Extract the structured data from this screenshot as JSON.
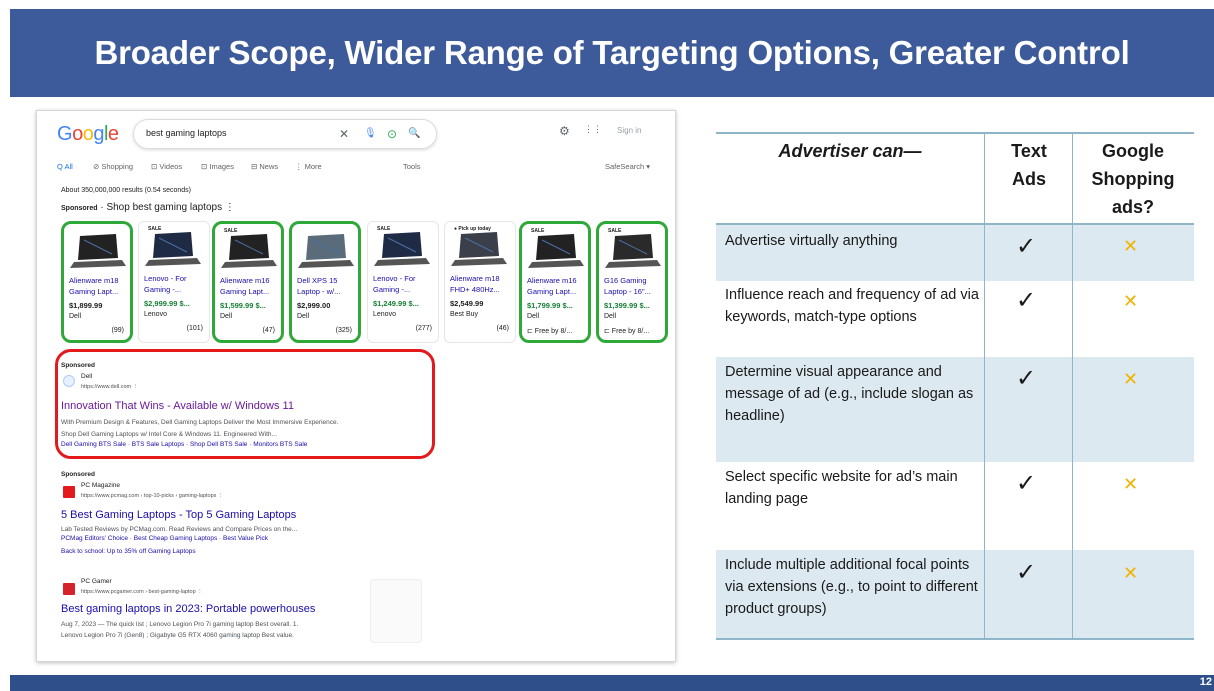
{
  "slide": {
    "title": "Broader Scope, Wider Range of Targeting Options, Greater Control",
    "page_number": "12"
  },
  "google": {
    "logo_letters": [
      {
        "ch": "G",
        "color": "#4285f4"
      },
      {
        "ch": "o",
        "color": "#ea4335"
      },
      {
        "ch": "o",
        "color": "#fbbc05"
      },
      {
        "ch": "g",
        "color": "#4285f4"
      },
      {
        "ch": "l",
        "color": "#34a853"
      },
      {
        "ch": "e",
        "color": "#ea4335"
      }
    ],
    "search_query": "best gaming laptops",
    "clear_icon": "✕",
    "mic_icon": "🎙",
    "lens_icon": "⊙",
    "search_icon": "🔍",
    "settings_icon": "⚙",
    "apps_icon": "⋮⋮",
    "sign_in": "Sign in",
    "tabs": [
      "Q All",
      "⊘ Shopping",
      "⊡ Videos",
      "⊡ Images",
      "⊟ News",
      "⋮ More"
    ],
    "tools": "Tools",
    "safesearch": "SafeSearch ▾",
    "result_stats": "About 350,000,000 results (0.54 seconds)",
    "sponsored_label": "Sponsored",
    "shop_heading": "Shop best gaming laptops",
    "shop_more": "⋮"
  },
  "products": [
    {
      "name": "Alienware m18 Gaming Lapt...",
      "price": "$1,899.99",
      "store": "Dell",
      "reviews": "(99)",
      "shipping": "",
      "sale": "",
      "sale_price": false,
      "highlight": true
    },
    {
      "name": "Lenovo - For Gaming -...",
      "price": "$2,999.99 $...",
      "store": "Lenovo",
      "reviews": "(101)",
      "shipping": "",
      "sale": "SALE",
      "sale_price": true,
      "highlight": false
    },
    {
      "name": "Alienware m16 Gaming Lapt...",
      "price": "$1,599.99 $...",
      "store": "Dell",
      "reviews": "(47)",
      "shipping": "",
      "sale": "SALE",
      "sale_price": true,
      "highlight": true
    },
    {
      "name": "Dell XPS 15 Laptop - w/...",
      "price": "$2,999.00",
      "store": "Dell",
      "reviews": "(325)",
      "shipping": "",
      "sale": "",
      "sale_price": false,
      "highlight": true
    },
    {
      "name": "Lenovo - For Gaming -...",
      "price": "$1,249.99 $...",
      "store": "Lenovo",
      "reviews": "(277)",
      "shipping": "",
      "sale": "SALE",
      "sale_price": true,
      "highlight": false
    },
    {
      "name": "Alienware m18 FHD+ 480Hz...",
      "price": "$2,549.99",
      "store": "Best Buy",
      "reviews": "(46)",
      "shipping": "",
      "sale": "● Pick up today",
      "sale_price": false,
      "highlight": false
    },
    {
      "name": "Alienware m16 Gaming Lapt...",
      "price": "$1,799.99 $...",
      "store": "Dell",
      "reviews": "",
      "shipping": "⊏ Free by 8/...",
      "sale": "SALE",
      "sale_price": true,
      "highlight": true
    },
    {
      "name": "G16 Gaming Laptop - 16\"...",
      "price": "$1,399.99 $...",
      "store": "Dell",
      "reviews": "",
      "shipping": "⊏ Free by 8/...",
      "sale": "SALE",
      "sale_price": true,
      "highlight": true
    }
  ],
  "dell_ad": {
    "sponsored": "Sponsored",
    "site": "Dell",
    "url": "https://www.dell.com   ⋮",
    "title": "Innovation That Wins - Available w/ Windows 11",
    "desc1": "With Premium Design & Features, Dell Gaming Laptops Deliver the Most Immersive Experience.",
    "desc2": "Shop Dell Gaming Laptops w/ Intel Core & Windows 11. Engineered With...",
    "links": "Dell Gaming BTS Sale · BTS Sale Laptops · Shop Dell BTS Sale · Monitors BTS Sale"
  },
  "pcmag_ad": {
    "sponsored": "Sponsored",
    "site": "PC Magazine",
    "url": "https://www.pcmag.com › top-10-picks › gaming-laptops   ⋮",
    "title": "5 Best Gaming Laptops - Top 5 Gaming Laptops",
    "desc1": "Lab Tested Reviews by PCMag.com. Read Reviews and Compare Prices on the...",
    "links": "PCMag Editors' Choice · Best Cheap Gaming Laptops · Best Value Pick",
    "desc2": "Back to school: Up to 35% off Gaming Laptops"
  },
  "pcgamer_result": {
    "site": "PC Gamer",
    "url": "https://www.pcgamer.com › best-gaming-laptop   ⋮",
    "title": "Best gaming laptops in 2023: Portable powerhouses",
    "desc1": "Aug 7, 2023 — The quick list ; Lenovo Legion Pro 7i gaming laptop Best overall. 1.",
    "desc2": "Lenovo Legion Pro 7i (Gen8) ; Gigabyte G5 RTX 4060 gaming laptop Best value."
  },
  "table": {
    "headers": [
      "Advertiser can—",
      "Text Ads",
      "Google Shopping ads?"
    ],
    "check_mark": "✓",
    "cross_mark": "✕",
    "rows": [
      {
        "text": "Advertise virtually anything",
        "text_ads": true,
        "shopping_ads": false
      },
      {
        "text": "Influence reach and frequency of ad via keywords, match-type options",
        "text_ads": true,
        "shopping_ads": false
      },
      {
        "text": "Determine visual appearance and message of ad (e.g., include slogan as headline)",
        "text_ads": true,
        "shopping_ads": false
      },
      {
        "text": "Select specific website for ad’s main landing page",
        "text_ads": true,
        "shopping_ads": false
      },
      {
        "text": "Include multiple additional focal points via extensions (e.g., to point to different product groups)",
        "text_ads": true,
        "shopping_ads": false
      }
    ]
  }
}
